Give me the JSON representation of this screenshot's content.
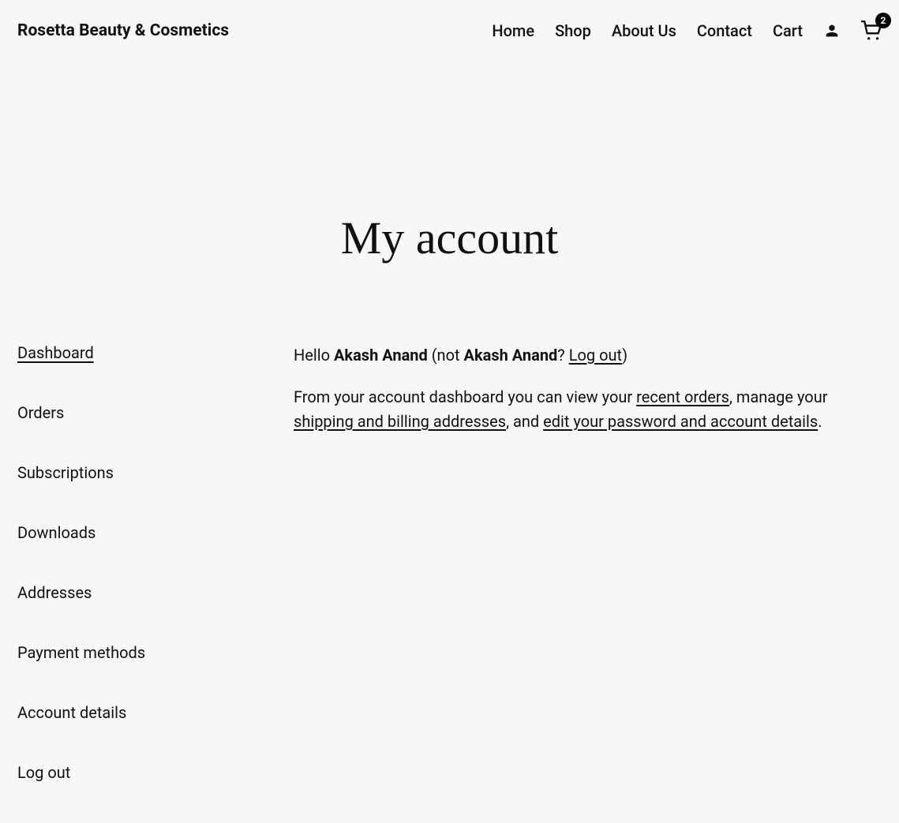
{
  "site_title": "Rosetta Beauty & Cosmetics",
  "nav": {
    "home": "Home",
    "shop": "Shop",
    "about": "About Us",
    "contact": "Contact",
    "cart": "Cart"
  },
  "cart_count": "2",
  "page_title": "My account",
  "sidebar": {
    "items": [
      {
        "label": "Dashboard",
        "active": true
      },
      {
        "label": "Orders",
        "active": false
      },
      {
        "label": "Subscriptions",
        "active": false
      },
      {
        "label": "Downloads",
        "active": false
      },
      {
        "label": "Addresses",
        "active": false
      },
      {
        "label": "Payment methods",
        "active": false
      },
      {
        "label": "Account details",
        "active": false
      },
      {
        "label": "Log out",
        "active": false
      }
    ]
  },
  "content": {
    "greeting_hello": "Hello ",
    "user_name": "Akash Anand",
    "not_prefix": " (not ",
    "not_user_name": "Akash Anand",
    "question_mark": "? ",
    "logout_link": "Log out",
    "close_paren": ")",
    "p2_a": "From your account dashboard you can view your ",
    "link_recent_orders": "recent orders",
    "p2_b": ", manage your ",
    "link_addresses": "shipping and billing addresses",
    "p2_c": ", and ",
    "link_account_details": "edit your password and account details",
    "p2_d": "."
  }
}
